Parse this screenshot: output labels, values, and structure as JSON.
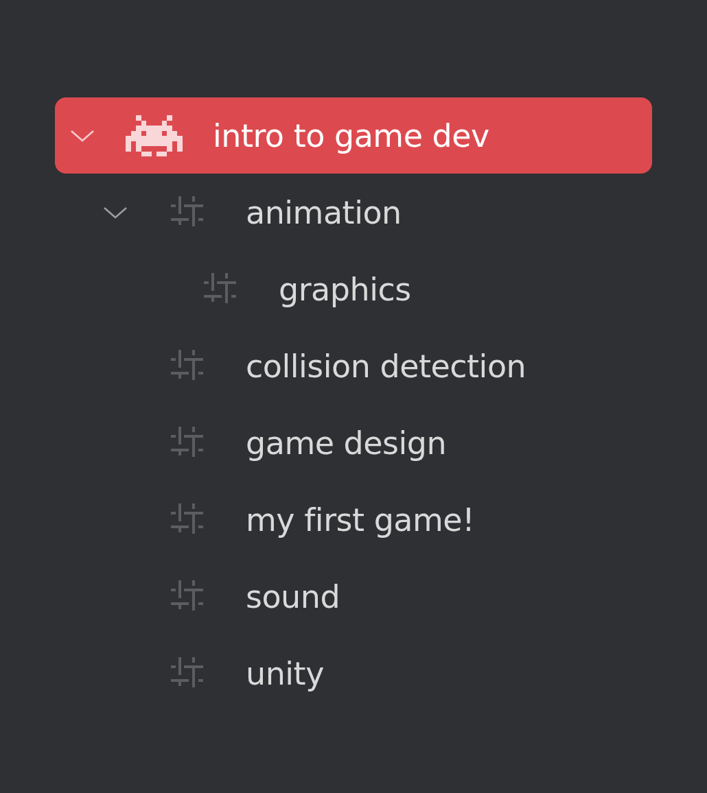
{
  "tree": [
    {
      "label": "intro to game dev",
      "kind": "project",
      "selected": true,
      "expanded": true,
      "children": [
        {
          "label": "animation",
          "kind": "tag",
          "selected": false,
          "expanded": true,
          "children": [
            {
              "label": "graphics",
              "kind": "tag",
              "selected": false
            }
          ]
        },
        {
          "label": "collision detection",
          "kind": "tag",
          "selected": false
        },
        {
          "label": "game design",
          "kind": "tag",
          "selected": false
        },
        {
          "label": "my first game!",
          "kind": "tag",
          "selected": false
        },
        {
          "label": "sound",
          "kind": "tag",
          "selected": false
        },
        {
          "label": "unity",
          "kind": "tag",
          "selected": false
        }
      ]
    }
  ]
}
